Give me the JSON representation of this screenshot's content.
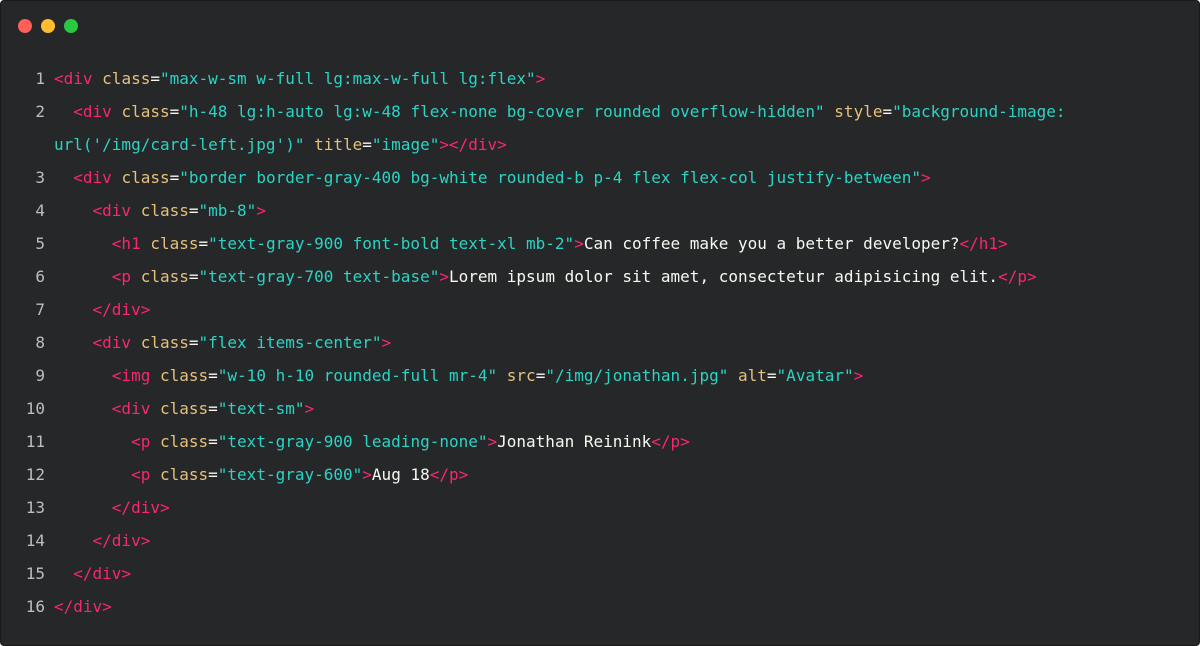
{
  "window": {
    "controls": [
      {
        "name": "close",
        "color": "#ff5f57"
      },
      {
        "name": "minimize",
        "color": "#febc2e"
      },
      {
        "name": "maximize",
        "color": "#28c840"
      }
    ]
  },
  "colors": {
    "background": "#262729",
    "line_number": "#bdbdbd",
    "tag": "#f92672",
    "attr": "#fd971f",
    "attr_alt": "#e6c07b",
    "string": "#2ad4c4",
    "text": "#f8f8f2"
  },
  "code_lines": [
    {
      "n": "1",
      "tokens": [
        {
          "t": "tag",
          "v": "<div "
        },
        {
          "t": "attr",
          "v": "class"
        },
        {
          "t": "txt",
          "v": "="
        },
        {
          "t": "str",
          "v": "\"max-w-sm w-full lg:max-w-full lg:flex\""
        },
        {
          "t": "tag",
          "v": ">"
        }
      ]
    },
    {
      "n": "2",
      "tokens": [
        {
          "t": "txt",
          "v": "  "
        },
        {
          "t": "tag",
          "v": "<div "
        },
        {
          "t": "attr",
          "v": "class"
        },
        {
          "t": "txt",
          "v": "="
        },
        {
          "t": "str",
          "v": "\"h-48 lg:h-auto lg:w-48 flex-none bg-cover rounded overflow-hidden\""
        },
        {
          "t": "txt",
          "v": " "
        },
        {
          "t": "attr",
          "v": "style"
        },
        {
          "t": "txt",
          "v": "="
        },
        {
          "t": "str",
          "v": "\"background-image: url('/img/card-left.jpg')\""
        },
        {
          "t": "txt",
          "v": " "
        },
        {
          "t": "attr",
          "v": "title"
        },
        {
          "t": "txt",
          "v": "="
        },
        {
          "t": "str",
          "v": "\"image\""
        },
        {
          "t": "tag",
          "v": "></div>"
        }
      ]
    },
    {
      "n": "3",
      "tokens": [
        {
          "t": "txt",
          "v": "  "
        },
        {
          "t": "tag",
          "v": "<div "
        },
        {
          "t": "attr",
          "v": "class"
        },
        {
          "t": "txt",
          "v": "="
        },
        {
          "t": "str",
          "v": "\"border border-gray-400 bg-white rounded-b p-4 flex flex-col justify-between\""
        },
        {
          "t": "tag",
          "v": ">"
        }
      ]
    },
    {
      "n": "4",
      "tokens": [
        {
          "t": "txt",
          "v": "    "
        },
        {
          "t": "tag",
          "v": "<div "
        },
        {
          "t": "attr",
          "v": "class"
        },
        {
          "t": "txt",
          "v": "="
        },
        {
          "t": "str",
          "v": "\"mb-8\""
        },
        {
          "t": "tag",
          "v": ">"
        }
      ]
    },
    {
      "n": "5",
      "tokens": [
        {
          "t": "txt",
          "v": "      "
        },
        {
          "t": "tag",
          "v": "<h1 "
        },
        {
          "t": "attr",
          "v": "class"
        },
        {
          "t": "txt",
          "v": "="
        },
        {
          "t": "str",
          "v": "\"text-gray-900 font-bold text-xl mb-2\""
        },
        {
          "t": "tag",
          "v": ">"
        },
        {
          "t": "txt",
          "v": "Can coffee make you a better developer?"
        },
        {
          "t": "tag",
          "v": "</h1>"
        }
      ]
    },
    {
      "n": "6",
      "tokens": [
        {
          "t": "txt",
          "v": "      "
        },
        {
          "t": "tag",
          "v": "<p "
        },
        {
          "t": "attr",
          "v": "class"
        },
        {
          "t": "txt",
          "v": "="
        },
        {
          "t": "str",
          "v": "\"text-gray-700 text-base\""
        },
        {
          "t": "tag",
          "v": ">"
        },
        {
          "t": "txt",
          "v": "Lorem ipsum dolor sit amet, consectetur adipisicing elit."
        },
        {
          "t": "tag",
          "v": "</p>"
        }
      ]
    },
    {
      "n": "7",
      "tokens": [
        {
          "t": "txt",
          "v": "    "
        },
        {
          "t": "tag",
          "v": "</div>"
        }
      ]
    },
    {
      "n": "8",
      "tokens": [
        {
          "t": "txt",
          "v": "    "
        },
        {
          "t": "tag",
          "v": "<div "
        },
        {
          "t": "attr",
          "v": "class"
        },
        {
          "t": "txt",
          "v": "="
        },
        {
          "t": "str",
          "v": "\"flex items-center\""
        },
        {
          "t": "tag",
          "v": ">"
        }
      ]
    },
    {
      "n": "9",
      "tokens": [
        {
          "t": "txt",
          "v": "      "
        },
        {
          "t": "tag",
          "v": "<img "
        },
        {
          "t": "attr",
          "v": "class"
        },
        {
          "t": "txt",
          "v": "="
        },
        {
          "t": "str",
          "v": "\"w-10 h-10 rounded-full mr-4\""
        },
        {
          "t": "txt",
          "v": " "
        },
        {
          "t": "attr",
          "v": "src"
        },
        {
          "t": "txt",
          "v": "="
        },
        {
          "t": "str",
          "v": "\"/img/jonathan.jpg\""
        },
        {
          "t": "txt",
          "v": " "
        },
        {
          "t": "attr",
          "v": "alt"
        },
        {
          "t": "txt",
          "v": "="
        },
        {
          "t": "str",
          "v": "\"Avatar\""
        },
        {
          "t": "tag",
          "v": ">"
        }
      ]
    },
    {
      "n": "10",
      "tokens": [
        {
          "t": "txt",
          "v": "      "
        },
        {
          "t": "tag",
          "v": "<div "
        },
        {
          "t": "attr",
          "v": "class"
        },
        {
          "t": "txt",
          "v": "="
        },
        {
          "t": "str",
          "v": "\"text-sm\""
        },
        {
          "t": "tag",
          "v": ">"
        }
      ]
    },
    {
      "n": "11",
      "tokens": [
        {
          "t": "txt",
          "v": "        "
        },
        {
          "t": "tag",
          "v": "<p "
        },
        {
          "t": "attr",
          "v": "class"
        },
        {
          "t": "txt",
          "v": "="
        },
        {
          "t": "str",
          "v": "\"text-gray-900 leading-none\""
        },
        {
          "t": "tag",
          "v": ">"
        },
        {
          "t": "txt",
          "v": "Jonathan Reinink"
        },
        {
          "t": "tag",
          "v": "</p>"
        }
      ]
    },
    {
      "n": "12",
      "tokens": [
        {
          "t": "txt",
          "v": "        "
        },
        {
          "t": "tag",
          "v": "<p "
        },
        {
          "t": "attr",
          "v": "class"
        },
        {
          "t": "txt",
          "v": "="
        },
        {
          "t": "str",
          "v": "\"text-gray-600\""
        },
        {
          "t": "tag",
          "v": ">"
        },
        {
          "t": "txt",
          "v": "Aug 18"
        },
        {
          "t": "tag",
          "v": "</p>"
        }
      ]
    },
    {
      "n": "13",
      "tokens": [
        {
          "t": "txt",
          "v": "      "
        },
        {
          "t": "tag",
          "v": "</div>"
        }
      ]
    },
    {
      "n": "14",
      "tokens": [
        {
          "t": "txt",
          "v": "    "
        },
        {
          "t": "tag",
          "v": "</div>"
        }
      ]
    },
    {
      "n": "15",
      "tokens": [
        {
          "t": "txt",
          "v": "  "
        },
        {
          "t": "tag",
          "v": "</div>"
        }
      ]
    },
    {
      "n": "16",
      "tokens": [
        {
          "t": "tag",
          "v": "</div>"
        }
      ]
    }
  ]
}
